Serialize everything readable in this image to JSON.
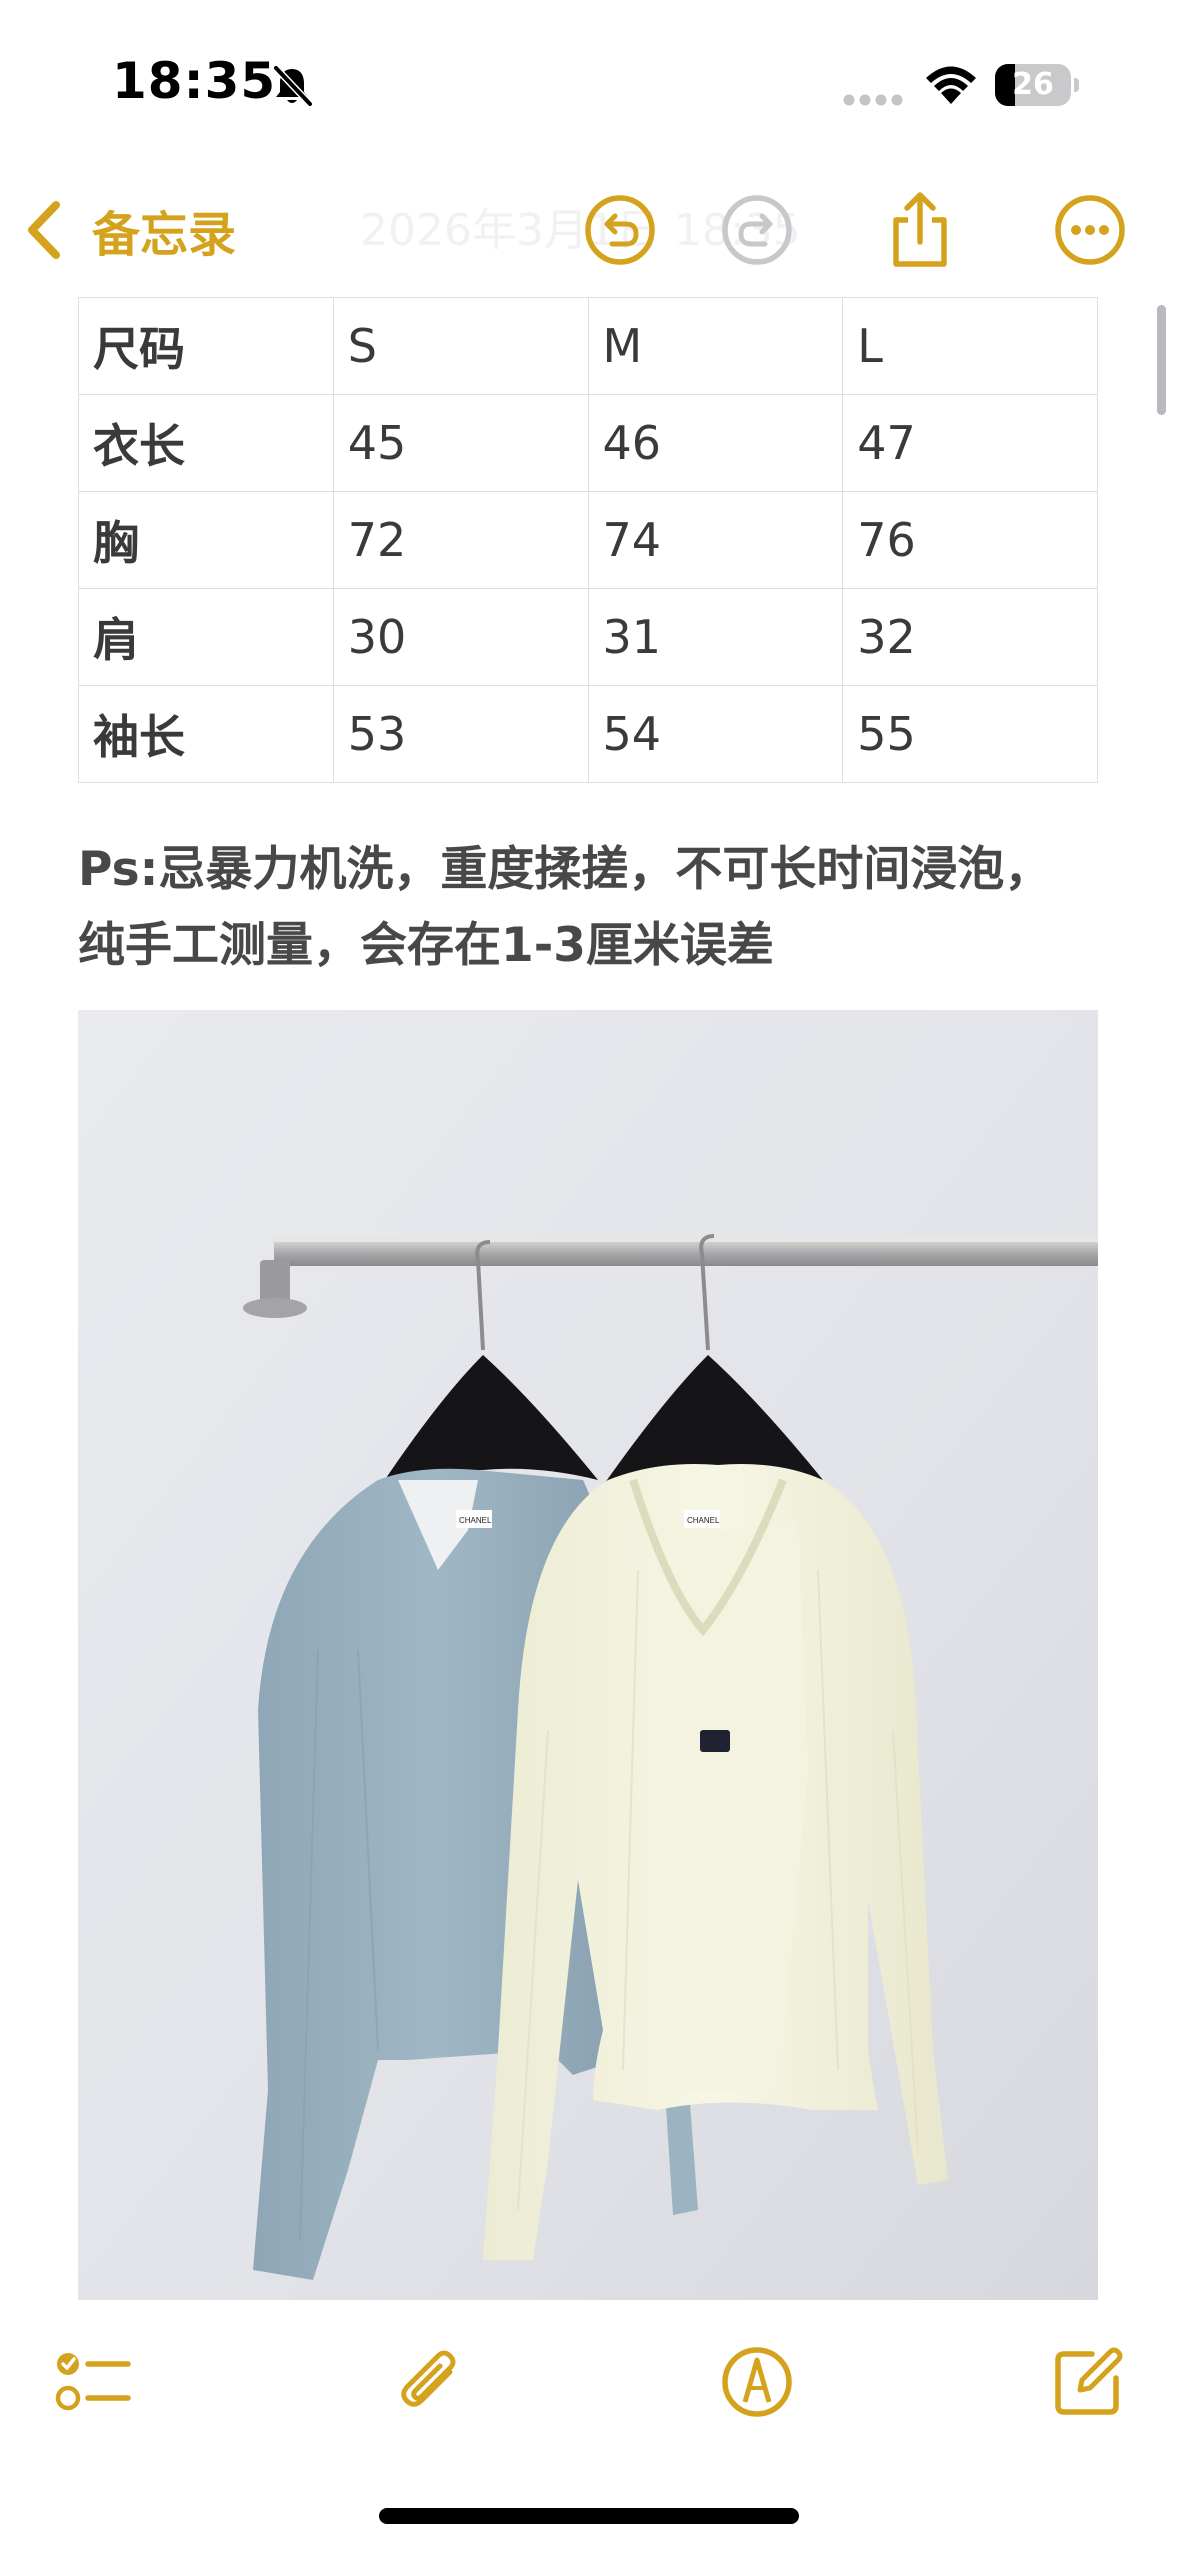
{
  "status_bar": {
    "time": "18:35",
    "battery_level": "26",
    "battery_fraction": 0.26
  },
  "nav": {
    "back_label": "备忘录",
    "date_ghost": "2026年3月1日 18:35",
    "icons": [
      "undo-icon",
      "redo-icon",
      "share-icon",
      "more-icon"
    ]
  },
  "size_table": {
    "headers": [
      "尺码",
      "S",
      "M",
      "L"
    ],
    "rows": [
      [
        "衣长",
        "45",
        "46",
        "47"
      ],
      [
        "胸",
        "72",
        "74",
        "76"
      ],
      [
        "肩",
        "30",
        "31",
        "32"
      ],
      [
        "袖长",
        "53",
        "54",
        "55"
      ]
    ]
  },
  "note": {
    "line1": "Ps:忌暴力机洗，重度揉搓，不可长时间浸泡，",
    "line2": "纯手工测量，会存在1-3厘米误差"
  },
  "photo": {
    "label_left": "CHANEL",
    "label_right": "CHANEL"
  },
  "toolbar": {
    "icons": [
      "checklist-icon",
      "attachment-icon",
      "markup-icon",
      "compose-icon"
    ]
  },
  "colors": {
    "accent": "#d4a21c",
    "text": "#3a3a3c",
    "table_border": "#dedee1",
    "cardigan_blue": "#98b0bf",
    "cardigan_cream": "#f3f1dc"
  }
}
